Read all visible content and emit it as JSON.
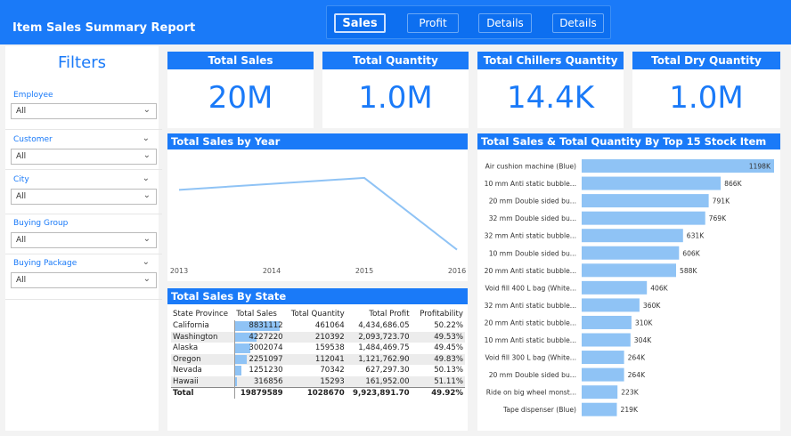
{
  "report": {
    "title": "Item Sales Summary Report"
  },
  "nav": {
    "buttons": [
      {
        "label": "Sales",
        "active": true
      },
      {
        "label": "Profit",
        "active": false
      },
      {
        "label": "Details",
        "active": false
      },
      {
        "label": "Details",
        "active": false
      }
    ]
  },
  "filters": {
    "title": "Filters",
    "slicers": [
      {
        "label": "Employee",
        "value": "All",
        "has_chevron": false
      },
      {
        "label": "Customer",
        "value": "All",
        "has_chevron": true
      },
      {
        "label": "City",
        "value": "All",
        "has_chevron": true
      },
      {
        "label": "Buying Group",
        "value": "All",
        "has_chevron": false
      },
      {
        "label": "Buying Package",
        "value": "All",
        "has_chevron": true
      }
    ]
  },
  "cards": [
    {
      "title": "Total Sales",
      "value": "20M"
    },
    {
      "title": "Total Quantity",
      "value": "1.0M"
    },
    {
      "title": "Total Chillers Quantity",
      "value": "14.4K"
    },
    {
      "title": "Total Dry Quantity",
      "value": "1.0M"
    }
  ],
  "colors": {
    "accent": "#1a7af8",
    "bar": "#8fc3f5",
    "line": "#8fc3f5"
  },
  "chart_data": [
    {
      "type": "line",
      "title": "Total Sales by Year",
      "x": [
        "2013",
        "2014",
        "2015",
        "2016"
      ],
      "values": [
        0.72,
        0.78,
        0.84,
        0.12
      ],
      "grid": false
    },
    {
      "type": "bar",
      "orientation": "horizontal",
      "title": "Total Sales & Total Quantity By Top 15 Stock Item",
      "categories": [
        "Air cushion machine (Blue)",
        "10 mm Anti static bubble...",
        "20 mm Double sided bu...",
        "32 mm Double sided bu...",
        "32 mm Anti static bubble...",
        "10 mm Double sided bu...",
        "20 mm Anti static bubble...",
        "Void fill 400 L bag (White...",
        "32 mm Anti static bubble...",
        "20 mm Anti static bubble...",
        "10 mm Anti static bubble...",
        "Void fill 300 L bag (White...",
        "20 mm Double sided bu...",
        "Ride on big wheel monst...",
        "Tape dispenser (Blue)"
      ],
      "values": [
        1198,
        866,
        791,
        769,
        631,
        606,
        588,
        406,
        360,
        310,
        304,
        264,
        264,
        223,
        219
      ],
      "labels": [
        "1198K",
        "866K",
        "791K",
        "769K",
        "631K",
        "606K",
        "588K",
        "406K",
        "360K",
        "310K",
        "304K",
        "264K",
        "264K",
        "223K",
        "219K"
      ],
      "xlim": [
        0,
        1198
      ]
    },
    {
      "type": "table",
      "title": "Total Sales By State",
      "columns": [
        "State Province",
        "Total Sales",
        "Total Quantity",
        "Total Profit",
        "Profitability"
      ],
      "rows": [
        [
          "California",
          "8831112",
          "461064",
          "4,434,686.05",
          "50.22%"
        ],
        [
          "Washington",
          "4227220",
          "210392",
          "2,093,723.70",
          "49.53%"
        ],
        [
          "Alaska",
          "3002074",
          "159538",
          "1,484,469.75",
          "49.45%"
        ],
        [
          "Oregon",
          "2251097",
          "112041",
          "1,121,762.90",
          "49.83%"
        ],
        [
          "Nevada",
          "1251230",
          "70342",
          "627,297.30",
          "50.13%"
        ],
        [
          "Hawaii",
          "316856",
          "15293",
          "161,952.00",
          "51.11%"
        ]
      ],
      "sales_values": [
        8831112,
        4227220,
        3002074,
        2251097,
        1251230,
        316856
      ],
      "total": [
        "Total",
        "19879589",
        "1028670",
        "9,923,891.70",
        "49.92%"
      ]
    }
  ]
}
